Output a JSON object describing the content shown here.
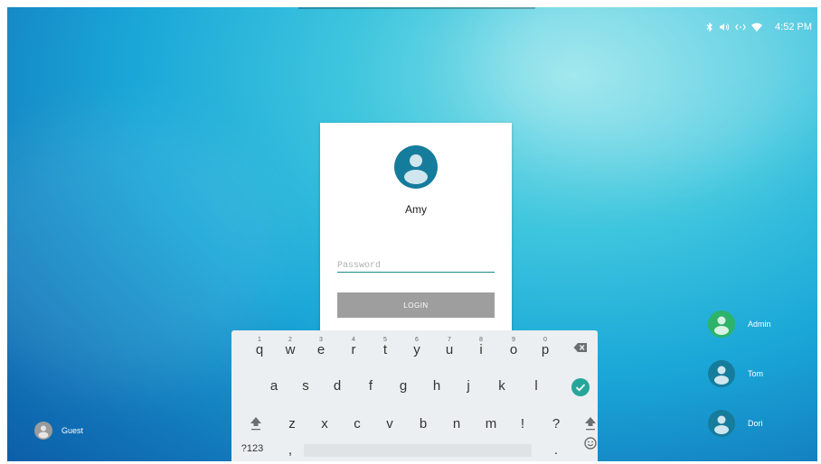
{
  "status": {
    "time": "4:52 PM",
    "icons": [
      "bluetooth-icon",
      "volume-icon",
      "ethernet-icon",
      "wifi-icon"
    ]
  },
  "login": {
    "user": "Amy",
    "password_placeholder": "Password",
    "password_value": "",
    "button": "LOGIN"
  },
  "users": [
    {
      "name": "Admin"
    },
    {
      "name": "Tom"
    },
    {
      "name": "Dori"
    }
  ],
  "guest": {
    "name": "Guest"
  },
  "keyboard": {
    "row1": [
      {
        "k": "q",
        "h": "1"
      },
      {
        "k": "w",
        "h": "2"
      },
      {
        "k": "e",
        "h": "3"
      },
      {
        "k": "r",
        "h": "4"
      },
      {
        "k": "t",
        "h": "5"
      },
      {
        "k": "y",
        "h": "6"
      },
      {
        "k": "u",
        "h": "7"
      },
      {
        "k": "i",
        "h": "8"
      },
      {
        "k": "o",
        "h": "9"
      },
      {
        "k": "p",
        "h": "0"
      }
    ],
    "row2": [
      "a",
      "s",
      "d",
      "f",
      "g",
      "h",
      "j",
      "k",
      "l"
    ],
    "row3": [
      "z",
      "x",
      "c",
      "v",
      "b",
      "n",
      "m",
      "!",
      "?"
    ],
    "row4": {
      "symbols": "?123",
      "comma": ",",
      "period": "."
    }
  },
  "colors": {
    "accent_teal": "#1b8c8c",
    "avatar_blue": "#167c9c",
    "avatar_green": "#2db36a",
    "enter_green": "#26a69a",
    "button_gray": "#9e9e9e"
  }
}
